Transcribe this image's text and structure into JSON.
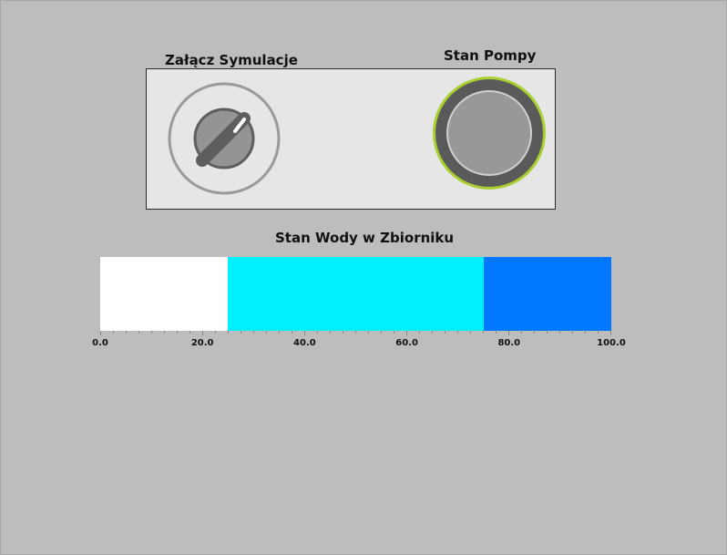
{
  "switch": {
    "label": "Załącz Symulacje"
  },
  "pump": {
    "label": "Stan Pompy"
  },
  "tank": {
    "label": "Stan Wody w Zbiorniku",
    "range": [
      0.0,
      100.0
    ],
    "bands": [
      {
        "from": 0.0,
        "to": 25.0,
        "color": "#ffffff"
      },
      {
        "from": 25.0,
        "to": 75.0,
        "color": "#00f0ff"
      },
      {
        "from": 75.0,
        "to": 100.0,
        "color": "#0078ff"
      }
    ],
    "ticks": [
      "0.0",
      "20.0",
      "40.0",
      "60.0",
      "80.0",
      "100.0"
    ],
    "tick_values": [
      0,
      20,
      40,
      60,
      80,
      100
    ]
  },
  "colors": {
    "background": "#bdbdbd",
    "panel": "#e6e6e6",
    "lamp_ring": "#a8d030",
    "knob": "#7a7a7a"
  }
}
